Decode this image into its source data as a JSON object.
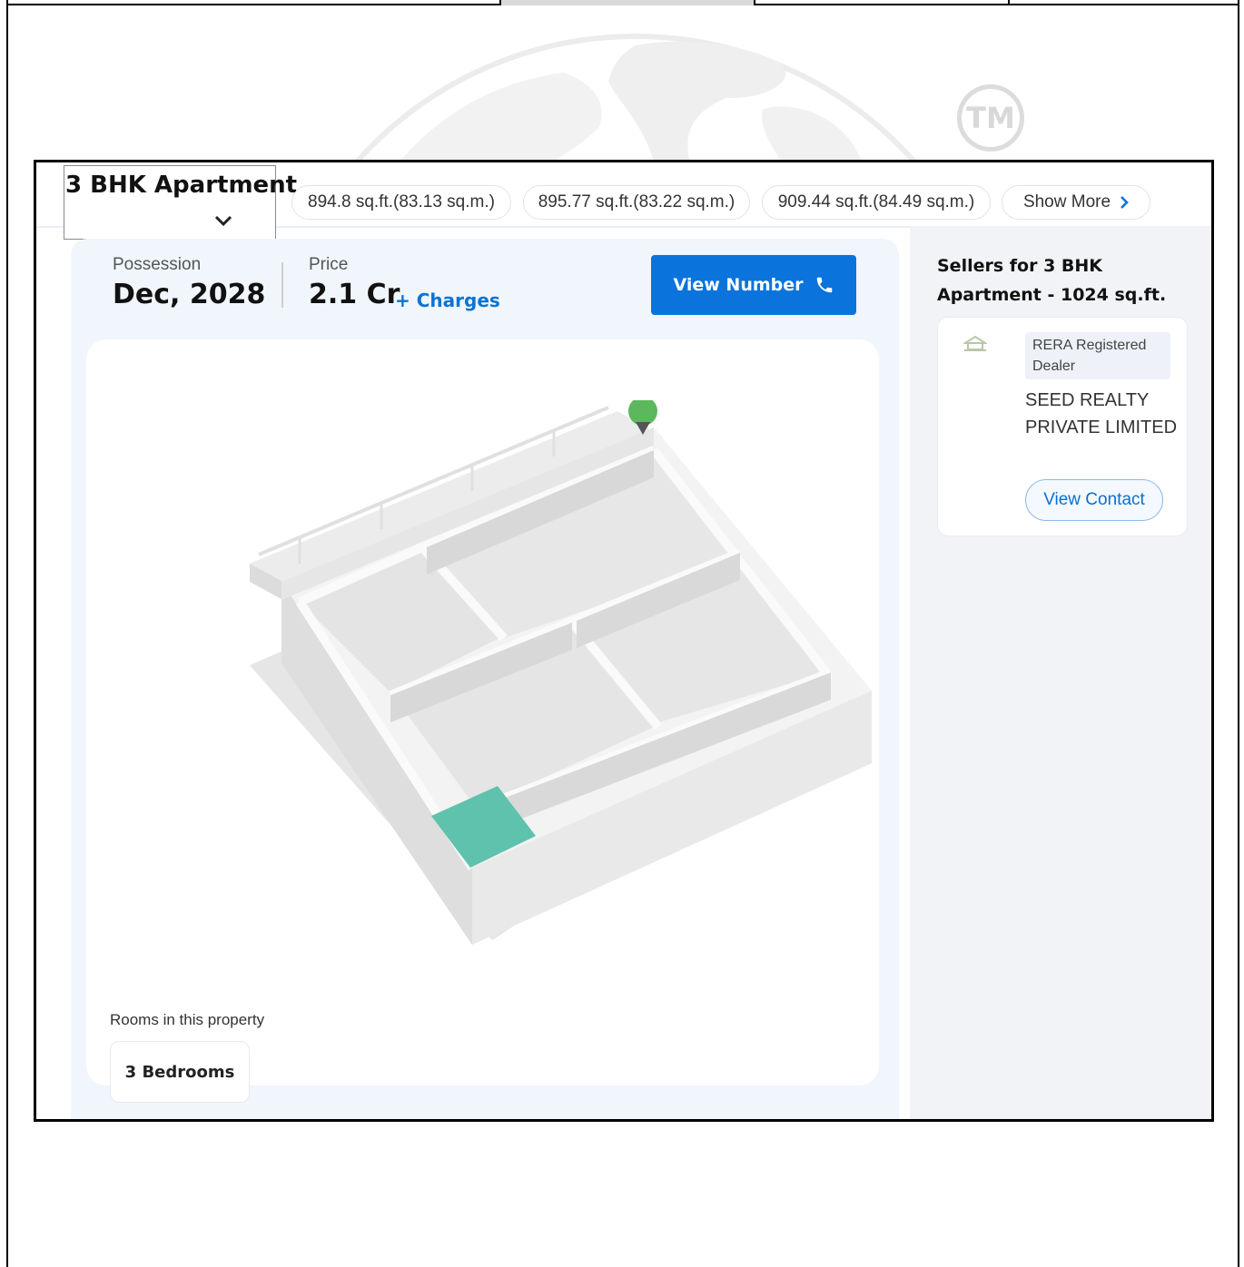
{
  "config": {
    "title": "3 BHK Apartment"
  },
  "area_options": [
    {
      "label": "894.8 sq.ft.(83.13 sq.m.)"
    },
    {
      "label": "895.77 sq.ft.(83.22 sq.m.)"
    },
    {
      "label": "909.44 sq.ft.(84.49 sq.m.)"
    }
  ],
  "show_more": {
    "label": "Show More"
  },
  "possession": {
    "label": "Possession",
    "value": "Dec, 2028"
  },
  "price": {
    "label": "Price",
    "value": "2.1 Cr",
    "charges": "+ Charges"
  },
  "view_number": {
    "label": "View Number"
  },
  "rooms": {
    "label": "Rooms in this property",
    "chips": [
      "3 Bedrooms"
    ]
  },
  "sellers": {
    "title": "Sellers for 3 BHK Apartment - 1024 sq.ft.",
    "card": {
      "badge": "RERA Registered Dealer",
      "name": "SEED REALTY PRIVATE LIMITED",
      "contact_label": "View Contact"
    }
  },
  "watermark": {
    "tm": "TM"
  },
  "colors": {
    "primary": "#0a74dc",
    "link": "#0a74d4",
    "room_highlight": "#5fc2ad",
    "marker": "#5cb85c"
  }
}
